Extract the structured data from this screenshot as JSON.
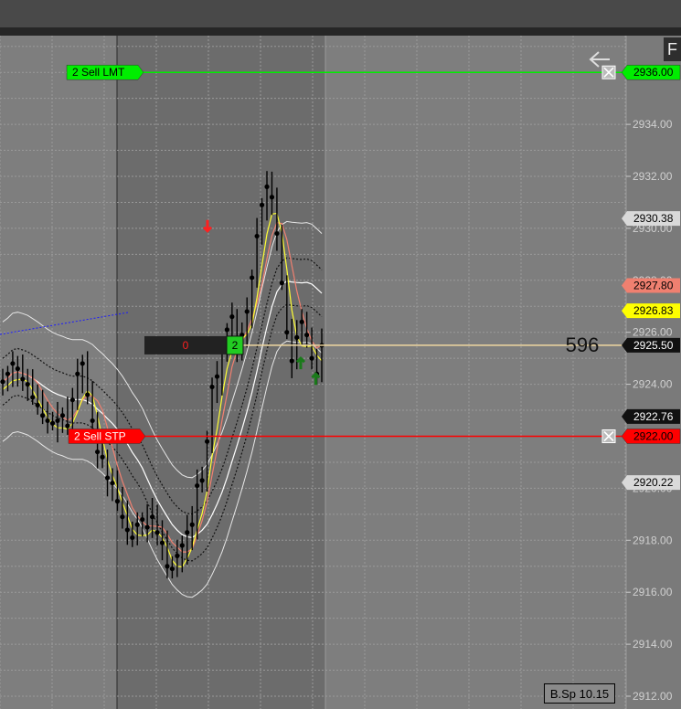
{
  "window": {
    "fullscreen_button": "F"
  },
  "chart_data": {
    "type": "candlestick",
    "price_axis": {
      "ticks": [
        "2934.00",
        "2932.00",
        "2930.00",
        "2928.00",
        "2926.00",
        "2924.00",
        "2922.00",
        "2920.00",
        "2918.00",
        "2916.00",
        "2914.00",
        "2912.00"
      ],
      "range": [
        2911.5,
        2937.2
      ]
    },
    "orders": [
      {
        "qty": "2",
        "label": "Sell LMT",
        "price_label": "2936.00",
        "price": 2936.0,
        "color": "#00ee00"
      },
      {
        "qty": "2",
        "label": "Sell STP",
        "price_label": "2922.00",
        "price": 2922.0,
        "color": "#ff0000"
      }
    ],
    "position": {
      "pnl": "0",
      "qty": "2",
      "price_label": "2925.50",
      "price": 2925.5,
      "ticks_away": "596"
    },
    "price_tags": [
      {
        "label": "2930.38",
        "price": 2930.38,
        "bg": "#d9d9d9",
        "fg": "#000000"
      },
      {
        "label": "2927.80",
        "price": 2927.8,
        "bg": "#f08070",
        "fg": "#000000"
      },
      {
        "label": "2926.83",
        "price": 2926.83,
        "bg": "#ffff00",
        "fg": "#000000"
      },
      {
        "label": "2922.76",
        "price": 2922.76,
        "bg": "#111111",
        "fg": "#ffffff"
      },
      {
        "label": "2920.22",
        "price": 2920.22,
        "bg": "#d9d9d9",
        "fg": "#000000"
      }
    ],
    "trade_arrows": [
      {
        "direction": "down",
        "color": "#ff2020",
        "price": 2929.9,
        "bar": 0.62
      },
      {
        "direction": "up",
        "color": "#1a7a1a",
        "price": 2925.0,
        "bar": 0.93
      },
      {
        "direction": "up",
        "color": "#1a7a1a",
        "price": 2924.4,
        "bar": 0.98
      }
    ],
    "stamp": "B.Sp 10.15",
    "closes": [
      2924.1,
      2924.4,
      2924.8,
      2924.6,
      2924.2,
      2924.0,
      2923.5,
      2923.2,
      2922.8,
      2922.6,
      2922.5,
      2922.6,
      2922.8,
      2922.4,
      2923.4,
      2924.4,
      2924.8,
      2923.6,
      2922.6,
      2921.4,
      2921.2,
      2920.4,
      2920.2,
      2919.5,
      2918.9,
      2918.4,
      2918.1,
      2918.6,
      2918.8,
      2918.5,
      2918.9,
      2918.3,
      2917.9,
      2917.0,
      2916.9,
      2917.4,
      2917.8,
      2918.3,
      2918.6,
      2920.1,
      2920.3,
      2921.8,
      2923.9,
      2924.3,
      2925.3,
      2926.1,
      2926.6,
      2925.6,
      2925.9,
      2926.8,
      2928.1,
      2929.7,
      2930.9,
      2931.6,
      2931.2,
      2929.8,
      2927.9,
      2926.0,
      2924.9,
      2925.8,
      2926.4,
      2925.9,
      2925.0,
      2924.4,
      2925.5
    ]
  }
}
